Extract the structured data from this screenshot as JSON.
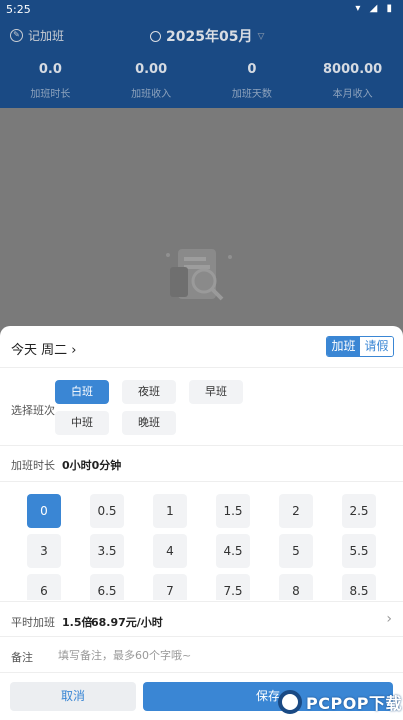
{
  "status_bar": {
    "time": "5:25"
  },
  "header": {
    "brand": "记加班",
    "month": "2025年05月",
    "stats": [
      {
        "value": "0.0",
        "label": "加班时长"
      },
      {
        "value": "0.00",
        "label": "加班收入"
      },
      {
        "value": "0",
        "label": "加班天数"
      },
      {
        "value": "8000.00",
        "label": "本月收入"
      }
    ]
  },
  "sheet": {
    "day_label": "今天 周二",
    "day_chevron": "›",
    "type_tabs": [
      {
        "label": "加班",
        "selected": true
      },
      {
        "label": "请假",
        "selected": false
      }
    ],
    "shift_label": "选择班次",
    "shifts": [
      {
        "label": "白班",
        "selected": true
      },
      {
        "label": "夜班",
        "selected": false
      },
      {
        "label": "早班",
        "selected": false
      },
      {
        "label": "中班",
        "selected": false
      },
      {
        "label": "晚班",
        "selected": false
      }
    ],
    "duration_label": "加班时长",
    "duration_value": "0小时0分钟",
    "hours": [
      "0",
      "0.5",
      "1",
      "1.5",
      "2",
      "2.5",
      "3",
      "3.5",
      "4",
      "4.5",
      "5",
      "5.5",
      "6",
      "6.5",
      "7",
      "7.5",
      "8",
      "8.5"
    ],
    "selected_hour": "0",
    "rate_label": "平时加班",
    "rate_multiplier": "1.5倍",
    "rate_value": "68.97元/小时",
    "rate_chevron": "›",
    "note_label": "备注",
    "note_placeholder": "填写备注，最多60个字哦~",
    "cancel_label": "取消",
    "save_label": "保存"
  },
  "watermark": {
    "text": "PCPOP下载"
  },
  "colors": {
    "header_bg": "#1a4a84",
    "accent": "#3a86d4"
  }
}
